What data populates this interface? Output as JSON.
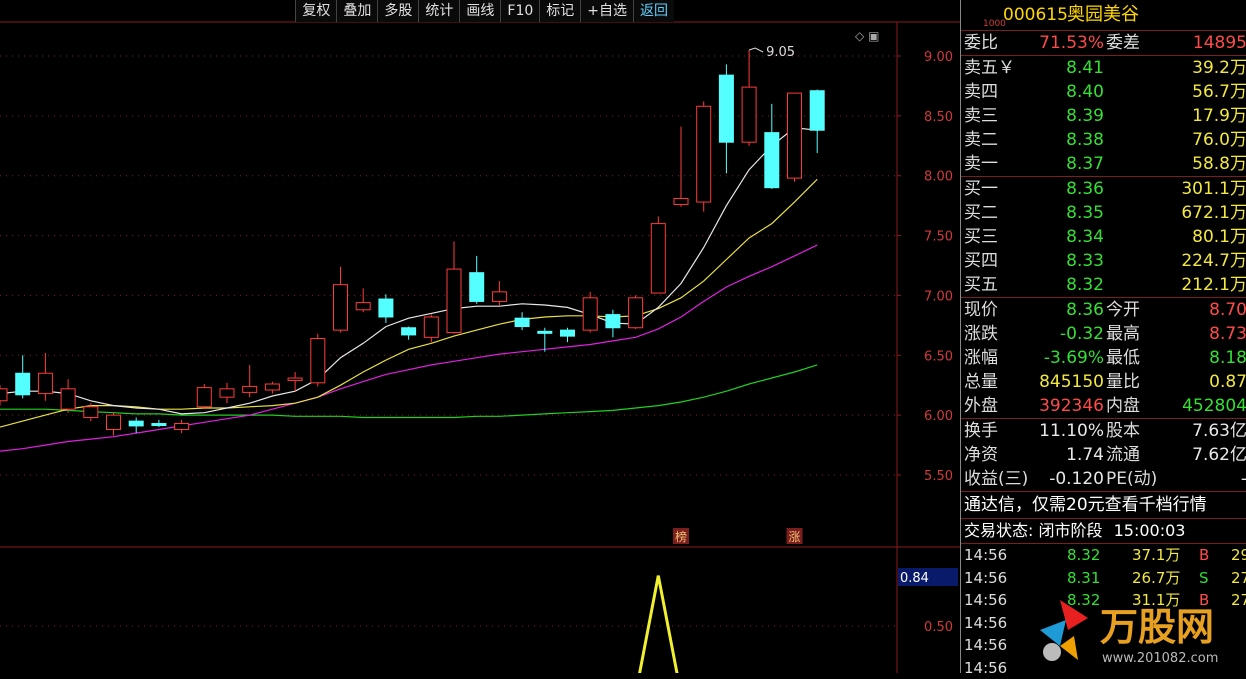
{
  "toolbar": {
    "buttons": [
      "复权",
      "叠加",
      "多股",
      "统计",
      "画线",
      "F10",
      "标记",
      "+自选",
      "返回"
    ]
  },
  "chart_data": {
    "type": "candlestick",
    "yticks": [
      "9.00",
      "8.50",
      "8.00",
      "7.50",
      "7.00",
      "6.50",
      "6.00",
      "5.50"
    ],
    "ylim": [
      5.3,
      9.35
    ],
    "high_label": "9.05",
    "markers": [
      "榜",
      "涨"
    ],
    "candles": [
      {
        "o": 6.12,
        "c": 6.22,
        "h": 6.25,
        "l": 6.08
      },
      {
        "o": 6.35,
        "c": 6.17,
        "h": 6.5,
        "l": 6.14
      },
      {
        "o": 6.18,
        "c": 6.35,
        "h": 6.52,
        "l": 6.12
      },
      {
        "o": 6.05,
        "c": 6.22,
        "h": 6.3,
        "l": 6.02
      },
      {
        "o": 5.98,
        "c": 6.07,
        "h": 6.1,
        "l": 5.95
      },
      {
        "o": 5.88,
        "c": 6.0,
        "h": 6.02,
        "l": 5.83
      },
      {
        "o": 5.95,
        "c": 5.91,
        "h": 5.98,
        "l": 5.85
      },
      {
        "o": 5.93,
        "c": 5.92,
        "h": 5.96,
        "l": 5.9
      },
      {
        "o": 5.88,
        "c": 5.93,
        "h": 5.96,
        "l": 5.85
      },
      {
        "o": 6.07,
        "c": 6.23,
        "h": 6.26,
        "l": 6.05
      },
      {
        "o": 6.15,
        "c": 6.22,
        "h": 6.27,
        "l": 6.1
      },
      {
        "o": 6.19,
        "c": 6.24,
        "h": 6.42,
        "l": 6.15
      },
      {
        "o": 6.21,
        "c": 6.26,
        "h": 6.28,
        "l": 6.18
      },
      {
        "o": 6.29,
        "c": 6.31,
        "h": 6.36,
        "l": 6.2
      },
      {
        "o": 6.27,
        "c": 6.64,
        "h": 6.68,
        "l": 6.24
      },
      {
        "o": 6.71,
        "c": 7.09,
        "h": 7.24,
        "l": 6.69
      },
      {
        "o": 6.88,
        "c": 6.94,
        "h": 7.06,
        "l": 6.86
      },
      {
        "o": 6.97,
        "c": 6.82,
        "h": 7.01,
        "l": 6.77
      },
      {
        "o": 6.73,
        "c": 6.67,
        "h": 6.74,
        "l": 6.63
      },
      {
        "o": 6.65,
        "c": 6.82,
        "h": 6.84,
        "l": 6.61
      },
      {
        "o": 6.69,
        "c": 7.22,
        "h": 7.45,
        "l": 6.68
      },
      {
        "o": 7.19,
        "c": 6.95,
        "h": 7.33,
        "l": 6.93
      },
      {
        "o": 6.95,
        "c": 7.03,
        "h": 7.12,
        "l": 6.92
      },
      {
        "o": 6.81,
        "c": 6.74,
        "h": 6.86,
        "l": 6.71
      },
      {
        "o": 6.7,
        "c": 6.69,
        "h": 6.73,
        "l": 6.53
      },
      {
        "o": 6.71,
        "c": 6.66,
        "h": 6.73,
        "l": 6.61
      },
      {
        "o": 6.71,
        "c": 6.98,
        "h": 7.03,
        "l": 6.69
      },
      {
        "o": 6.84,
        "c": 6.73,
        "h": 6.88,
        "l": 6.65
      },
      {
        "o": 6.73,
        "c": 6.98,
        "h": 7.0,
        "l": 6.72
      },
      {
        "o": 7.02,
        "c": 7.6,
        "h": 7.66,
        "l": 7.02
      },
      {
        "o": 7.76,
        "c": 7.81,
        "h": 8.41,
        "l": 7.74
      },
      {
        "o": 7.78,
        "c": 8.58,
        "h": 8.62,
        "l": 7.7
      },
      {
        "o": 8.84,
        "c": 8.28,
        "h": 8.93,
        "l": 8.02
      },
      {
        "o": 8.28,
        "c": 8.74,
        "h": 9.05,
        "l": 8.25
      },
      {
        "o": 8.36,
        "c": 7.9,
        "h": 8.6,
        "l": 7.89
      },
      {
        "o": 7.98,
        "c": 8.69,
        "h": 8.69,
        "l": 7.95
      },
      {
        "o": 8.71,
        "c": 8.38,
        "h": 8.72,
        "l": 8.19
      }
    ],
    "ma_white": [
      6.18,
      6.2,
      6.2,
      6.18,
      6.12,
      6.08,
      6.06,
      6.05,
      6.01,
      6.02,
      6.06,
      6.1,
      6.16,
      6.2,
      6.3,
      6.48,
      6.6,
      6.74,
      6.81,
      6.85,
      6.89,
      6.91,
      6.91,
      6.93,
      6.92,
      6.9,
      6.84,
      6.77,
      6.76,
      6.9,
      7.1,
      7.4,
      7.75,
      8.05,
      8.25,
      8.4,
      8.38
    ],
    "ma_yellow": [
      5.9,
      5.95,
      6.0,
      6.05,
      6.08,
      6.08,
      6.07,
      6.05,
      6.05,
      6.06,
      6.06,
      6.07,
      6.08,
      6.1,
      6.15,
      6.25,
      6.36,
      6.46,
      6.55,
      6.6,
      6.66,
      6.71,
      6.76,
      6.8,
      6.82,
      6.83,
      6.83,
      6.82,
      6.83,
      6.89,
      6.98,
      7.12,
      7.3,
      7.48,
      7.6,
      7.78,
      7.97
    ],
    "ma_magenta": [
      5.7,
      5.72,
      5.75,
      5.78,
      5.8,
      5.82,
      5.85,
      5.88,
      5.91,
      5.94,
      5.97,
      6.0,
      6.05,
      6.1,
      6.15,
      6.22,
      6.28,
      6.34,
      6.38,
      6.42,
      6.45,
      6.48,
      6.51,
      6.53,
      6.55,
      6.57,
      6.59,
      6.62,
      6.65,
      6.72,
      6.82,
      6.95,
      7.07,
      7.16,
      7.24,
      7.33,
      7.42
    ],
    "ma_green": [
      6.05,
      6.05,
      6.05,
      6.04,
      6.03,
      6.02,
      6.01,
      6.01,
      6.0,
      6.0,
      6.0,
      6.0,
      6.0,
      5.99,
      5.99,
      5.99,
      5.98,
      5.98,
      5.98,
      5.98,
      5.98,
      5.99,
      5.99,
      6.0,
      6.01,
      6.02,
      6.03,
      6.04,
      6.06,
      6.08,
      6.11,
      6.15,
      6.2,
      6.26,
      6.31,
      6.36,
      6.42
    ],
    "indicator": {
      "value_label": "0.84",
      "ytick": "0.50",
      "peak_index": 29,
      "peak_value": 0.92
    }
  },
  "panel": {
    "tag": "1000",
    "code": "000615",
    "name": "奥园美谷",
    "wei": [
      {
        "label": "委比",
        "value": "71.53%",
        "label2": "委差",
        "value2": "14895"
      }
    ],
    "sell": [
      {
        "label": "卖五￥",
        "price": "8.41",
        "vol": "39.2万"
      },
      {
        "label": "卖四",
        "price": "8.40",
        "vol": "56.7万"
      },
      {
        "label": "卖三",
        "price": "8.39",
        "vol": "17.9万"
      },
      {
        "label": "卖二",
        "price": "8.38",
        "vol": "76.0万"
      },
      {
        "label": "卖一",
        "price": "8.37",
        "vol": "58.8万"
      }
    ],
    "buy": [
      {
        "label": "买一",
        "price": "8.36",
        "vol": "301.1万"
      },
      {
        "label": "买二",
        "price": "8.35",
        "vol": "672.1万"
      },
      {
        "label": "买三",
        "price": "8.34",
        "vol": "80.1万"
      },
      {
        "label": "买四",
        "price": "8.33",
        "vol": "224.7万"
      },
      {
        "label": "买五",
        "price": "8.32",
        "vol": "212.1万"
      }
    ],
    "quote": [
      {
        "l1": "现价",
        "v1": "8.36",
        "l2": "今开",
        "v2": "8.70"
      },
      {
        "l1": "涨跌",
        "v1": "-0.32",
        "l2": "最高",
        "v2": "8.73"
      },
      {
        "l1": "涨幅",
        "v1": "-3.69%",
        "l2": "最低",
        "v2": "8.18"
      },
      {
        "l1": "总量",
        "v1": "845150",
        "l2": "量比",
        "v2": "0.87"
      },
      {
        "l1": "外盘",
        "v1": "392346",
        "l2": "内盘",
        "v2": "452804"
      }
    ],
    "stats": [
      {
        "l1": "换手",
        "v1": "11.10%",
        "l2": "股本",
        "v2": "7.63亿"
      },
      {
        "l1": "净资",
        "v1": "1.74",
        "l2": "流通",
        "v2": "7.62亿"
      },
      {
        "l1": "收益(三)",
        "v1": "-0.120",
        "l2": "PE(动)",
        "v2": "-"
      }
    ],
    "ad_text": "通达信，仅需20元查看千档行情",
    "status_label": "交易状态:",
    "status_value": "闭市阶段",
    "status_time": "15:00:03",
    "ticks": [
      {
        "t": "14:56",
        "p": "8.32",
        "v": "37.1万",
        "d": "B",
        "n": "29"
      },
      {
        "t": "14:56",
        "p": "8.31",
        "v": "26.7万",
        "d": "S",
        "n": "27"
      },
      {
        "t": "14:56",
        "p": "8.32",
        "v": "31.1万",
        "d": "B",
        "n": "27"
      },
      {
        "t": "14:56",
        "p": "",
        "v": "",
        "d": "",
        "n": ""
      },
      {
        "t": "14:56",
        "p": "",
        "v": "",
        "d": "",
        "n": ""
      },
      {
        "t": "14:56",
        "p": "",
        "v": "",
        "d": "",
        "n": ""
      }
    ],
    "watermark": {
      "brand": "万股网",
      "url": "www.201082.com"
    }
  },
  "colors": {
    "up": "#ff3a3a",
    "down": "#54ffff",
    "ma_white": "#e8e8e8",
    "ma_yellow": "#e8e040",
    "ma_magenta": "#e020e0",
    "ma_green": "#20d020",
    "grid": "#8a1a1a"
  }
}
